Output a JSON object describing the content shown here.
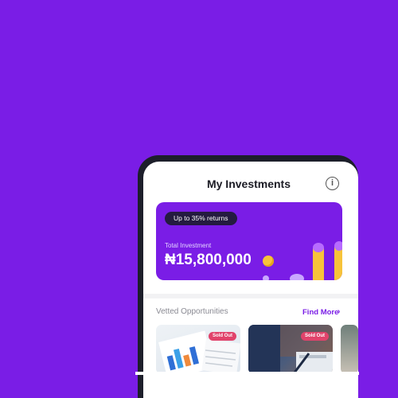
{
  "header": {
    "title": "My Investments",
    "info_icon": "info-icon"
  },
  "investment_card": {
    "badge": "Up to 35% returns",
    "total_label": "Total Investment",
    "total_value": "₦15,800,000"
  },
  "opportunities": {
    "title": "Vetted Opportunities",
    "find_more": "Find More",
    "chevron": "›",
    "cards": [
      {
        "badge": "Sold Out"
      },
      {
        "badge": "Sold Out"
      }
    ]
  },
  "colors": {
    "brand": "#7a1de6",
    "badge": "#e1436b",
    "coin": "#f7c33a"
  }
}
